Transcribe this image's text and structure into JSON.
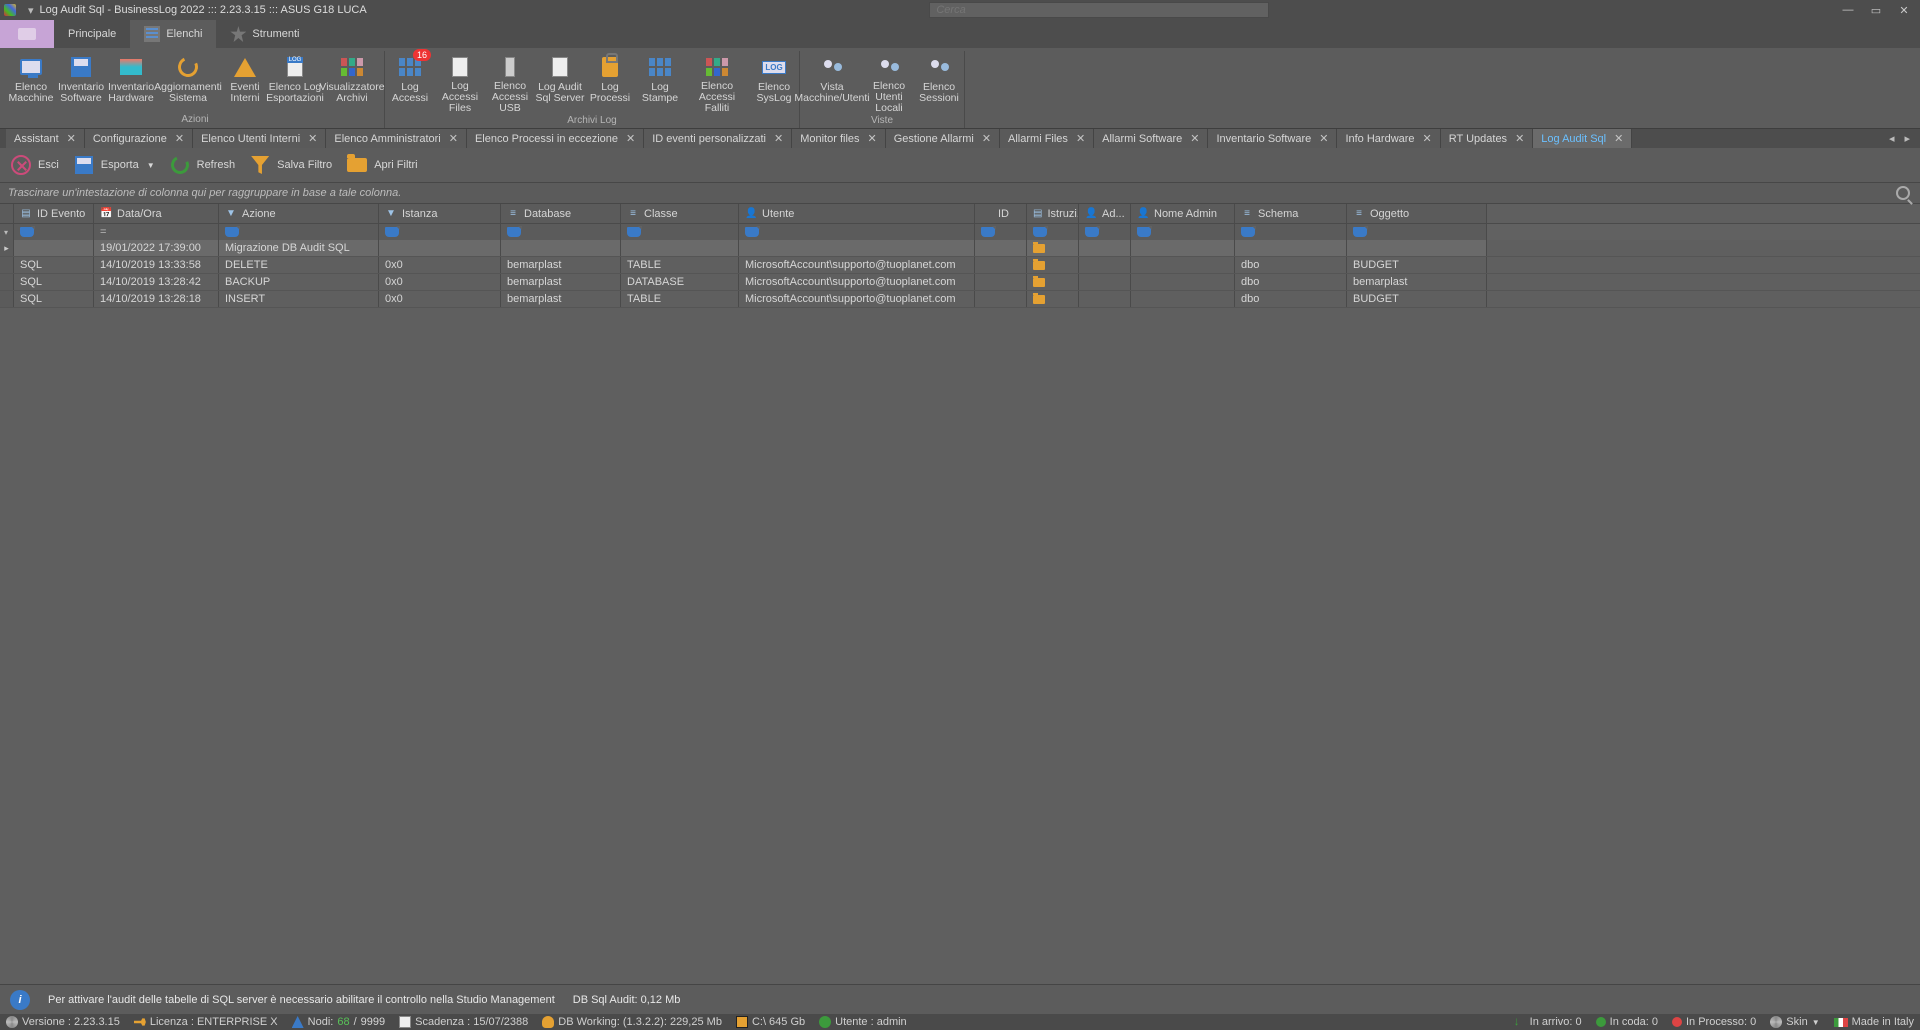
{
  "title": "Log Audit Sql - BusinessLog 2022 ::: 2.23.3.15 ::: ASUS G18 LUCA",
  "search_placeholder": "Cerca",
  "menu_tabs": {
    "principale": "Principale",
    "elenchi": "Elenchi",
    "strumenti": "Strumenti"
  },
  "ribbon": {
    "groups": [
      {
        "label": "Azioni",
        "items": [
          {
            "name": "elenco-macchine",
            "label": "Elenco\nMacchine",
            "icon": "monitor"
          },
          {
            "name": "inventario-software",
            "label": "Inventario\nSoftware",
            "icon": "floppy"
          },
          {
            "name": "inventario-hardware",
            "label": "Inventario\nHardware",
            "icon": "chip"
          },
          {
            "name": "aggiornamenti-sistema",
            "label": "Aggiornamenti\nSistema",
            "icon": "refresh",
            "wide": true
          },
          {
            "name": "eventi-interni",
            "label": "Eventi\nInterni",
            "icon": "alert"
          },
          {
            "name": "elenco-log-esportazioni",
            "label": "Elenco Log\nEsportazioni",
            "icon": "doclog"
          },
          {
            "name": "visualizzatore-archivi",
            "label": "Visualizzatore\nArchivi",
            "icon": "gridc",
            "wide": true
          }
        ]
      },
      {
        "label": "Archivi Log",
        "items": [
          {
            "name": "log-accessi",
            "label": "Log Accessi",
            "icon": "grid",
            "badge": "16"
          },
          {
            "name": "log-accessi-files",
            "label": "Log Accessi\nFiles",
            "icon": "doc-lock"
          },
          {
            "name": "elenco-accessi-usb",
            "label": "Elenco\nAccessi USB",
            "icon": "usb"
          },
          {
            "name": "log-audit-sql",
            "label": "Log Audit\nSql Server",
            "icon": "doc-db"
          },
          {
            "name": "log-processi",
            "label": "Log Processi",
            "icon": "clip"
          },
          {
            "name": "log-stampe",
            "label": "Log Stampe",
            "icon": "grid"
          },
          {
            "name": "elenco-accessi-falliti",
            "label": "Elenco Accessi\nFalliti",
            "icon": "gridc",
            "wide": true
          },
          {
            "name": "elenco-syslog",
            "label": "Elenco\nSysLog",
            "icon": "log"
          }
        ]
      },
      {
        "label": "Viste",
        "items": [
          {
            "name": "vista-macchine-utenti",
            "label": "Vista\nMacchine/Utenti",
            "icon": "users",
            "wide": true
          },
          {
            "name": "elenco-utenti-locali",
            "label": "Elenco Utenti\nLocali",
            "icon": "usersgrid"
          },
          {
            "name": "elenco-sessioni",
            "label": "Elenco\nSessioni",
            "icon": "usersgrid"
          }
        ]
      }
    ]
  },
  "doc_tabs": [
    {
      "name": "assistant",
      "label": "Assistant"
    },
    {
      "name": "configurazione",
      "label": "Configurazione"
    },
    {
      "name": "elenco-utenti-interni",
      "label": "Elenco Utenti Interni"
    },
    {
      "name": "elenco-amministratori",
      "label": "Elenco Amministratori"
    },
    {
      "name": "elenco-processi-eccezione",
      "label": "Elenco Processi in eccezione"
    },
    {
      "name": "id-eventi-personalizzati",
      "label": "ID eventi personalizzati"
    },
    {
      "name": "monitor-files",
      "label": "Monitor files"
    },
    {
      "name": "gestione-allarmi",
      "label": "Gestione Allarmi"
    },
    {
      "name": "allarmi-files",
      "label": "Allarmi Files"
    },
    {
      "name": "allarmi-software",
      "label": "Allarmi Software"
    },
    {
      "name": "inventario-software-tab",
      "label": "Inventario Software"
    },
    {
      "name": "info-hardware",
      "label": "Info Hardware"
    },
    {
      "name": "rt-updates",
      "label": "RT Updates"
    },
    {
      "name": "log-audit-sql-tab",
      "label": "Log Audit Sql",
      "active": true
    }
  ],
  "toolbar": {
    "esci": "Esci",
    "esporta": "Esporta",
    "refresh": "Refresh",
    "salva_filtro": "Salva Filtro",
    "apri_filtri": "Apri Filtri"
  },
  "groupby_hint": "Trascinare un'intestazione di colonna qui per raggruppare in base a tale colonna.",
  "columns": [
    {
      "key": "id_evento",
      "label": "ID Evento",
      "icon": "list"
    },
    {
      "key": "data_ora",
      "label": "Data/Ora",
      "icon": "cal"
    },
    {
      "key": "azione",
      "label": "Azione",
      "icon": "filter"
    },
    {
      "key": "istanza",
      "label": "Istanza",
      "icon": "filter"
    },
    {
      "key": "database",
      "label": "Database",
      "icon": "db"
    },
    {
      "key": "classe",
      "label": "Classe",
      "icon": "db"
    },
    {
      "key": "utente",
      "label": "Utente",
      "icon": "user"
    },
    {
      "key": "id",
      "label": "ID",
      "icon": ""
    },
    {
      "key": "istruzi",
      "label": "Istruzi...",
      "icon": "list"
    },
    {
      "key": "ad",
      "label": "Ad...",
      "icon": "user"
    },
    {
      "key": "nome_admin",
      "label": "Nome Admin",
      "icon": "user"
    },
    {
      "key": "schema",
      "label": "Schema",
      "icon": "db"
    },
    {
      "key": "oggetto",
      "label": "Oggetto",
      "icon": "db"
    }
  ],
  "filter_placeholder_date": "=",
  "rows": [
    {
      "sel": true,
      "id_evento": "",
      "data_ora": "19/01/2022 17:39:00",
      "azione": "Migrazione DB Audit SQL",
      "istanza": "",
      "database": "",
      "classe": "",
      "utente": "",
      "id": "",
      "istruzi": "📁",
      "ad": "",
      "nome_admin": "",
      "schema": "",
      "oggetto": ""
    },
    {
      "id_evento": "SQL",
      "data_ora": "14/10/2019 13:33:58",
      "azione": "DELETE",
      "istanza": "0x0",
      "database": "bemarplast",
      "classe": "TABLE",
      "utente": "MicrosoftAccount\\supporto@tuoplanet.com",
      "id": "",
      "istruzi": "📁",
      "ad": "",
      "nome_admin": "",
      "schema": "dbo",
      "oggetto": "BUDGET"
    },
    {
      "id_evento": "SQL",
      "data_ora": "14/10/2019 13:28:42",
      "azione": "BACKUP",
      "istanza": "0x0",
      "database": "bemarplast",
      "classe": "DATABASE",
      "utente": "MicrosoftAccount\\supporto@tuoplanet.com",
      "id": "",
      "istruzi": "📁",
      "ad": "",
      "nome_admin": "",
      "schema": "dbo",
      "oggetto": "bemarplast"
    },
    {
      "id_evento": "SQL",
      "data_ora": "14/10/2019 13:28:18",
      "azione": "INSERT",
      "istanza": "0x0",
      "database": "bemarplast",
      "classe": "TABLE",
      "utente": "MicrosoftAccount\\supporto@tuoplanet.com",
      "id": "",
      "istruzi": "📁",
      "ad": "",
      "nome_admin": "",
      "schema": "dbo",
      "oggetto": "BUDGET"
    }
  ],
  "info": {
    "msg": "Per attivare l'audit delle tabelle di SQL server è necessario abilitare il controllo nella Studio Management",
    "size": "DB Sql Audit: 0,12 Mb"
  },
  "status": {
    "versione": "Versione : 2.23.3.15",
    "licenza": "Licenza : ENTERPRISE X",
    "nodi_lbl": "Nodi:",
    "nodi_cur": "68",
    "nodi_sep": " / ",
    "nodi_max": "9999",
    "scadenza": "Scadenza : 15/07/2388",
    "dbworking": "DB Working: (1.3.2.2): 229,25 Mb",
    "disk": "C:\\ 645 Gb",
    "utente": "Utente : admin",
    "in_arrivo": "In arrivo: 0",
    "in_coda": "In coda: 0",
    "in_processo": "In Processo: 0",
    "skin": "Skin",
    "made": "Made in Italy"
  }
}
